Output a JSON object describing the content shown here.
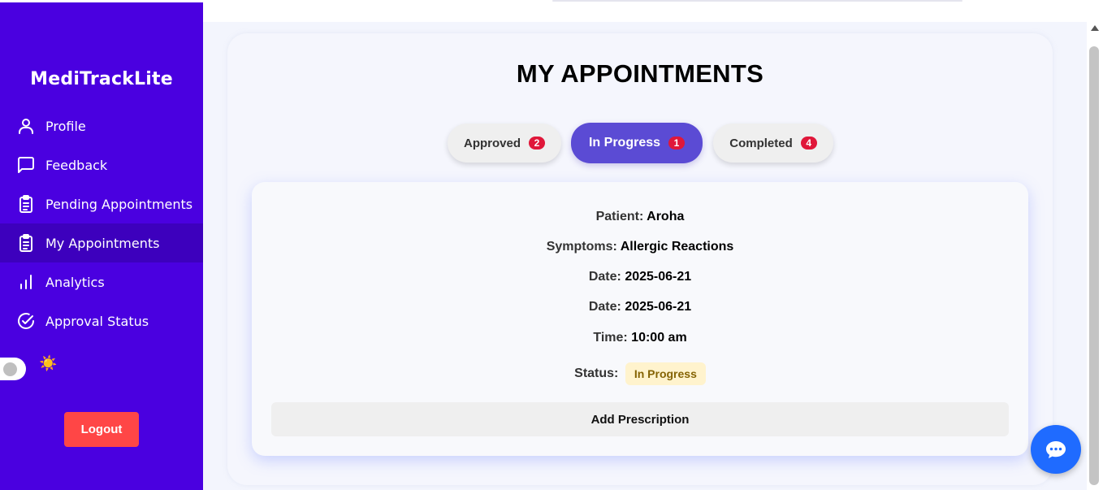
{
  "sidebar": {
    "brand": "MediTrackLite",
    "items": [
      {
        "label": "Profile",
        "icon": "user-icon"
      },
      {
        "label": "Feedback",
        "icon": "message-square-icon"
      },
      {
        "label": "Pending Appointments",
        "icon": "clipboard-list-icon"
      },
      {
        "label": "My Appointments",
        "icon": "clipboard-list-icon",
        "active": true
      },
      {
        "label": "Analytics",
        "icon": "bar-chart-icon"
      },
      {
        "label": "Approval Status",
        "icon": "check-circle-icon"
      }
    ],
    "theme_icon": "☀️",
    "logout_label": "Logout"
  },
  "page": {
    "title": "MY APPOINTMENTS"
  },
  "tabs": [
    {
      "label": "Approved",
      "count": "2"
    },
    {
      "label": "In Progress",
      "count": "1",
      "active": true
    },
    {
      "label": "Completed",
      "count": "4"
    }
  ],
  "appointment": {
    "patient_label": "Patient:",
    "patient": "Aroha",
    "symptoms_label": "Symptoms:",
    "symptoms": "Allergic Reactions",
    "date_label": "Date:",
    "date": "2025-06-21",
    "date2_label": "Date:",
    "date2": "2025-06-21",
    "time_label": "Time:",
    "time": "10:00 am",
    "status_label": "Status:",
    "status": "In Progress",
    "action_label": "Add Prescription"
  },
  "colors": {
    "sidebar": "#4a00e0",
    "active_tab": "#5b4bd4",
    "badge": "#e0173a",
    "logout": "#ff4646",
    "chat": "#1f6bff"
  }
}
